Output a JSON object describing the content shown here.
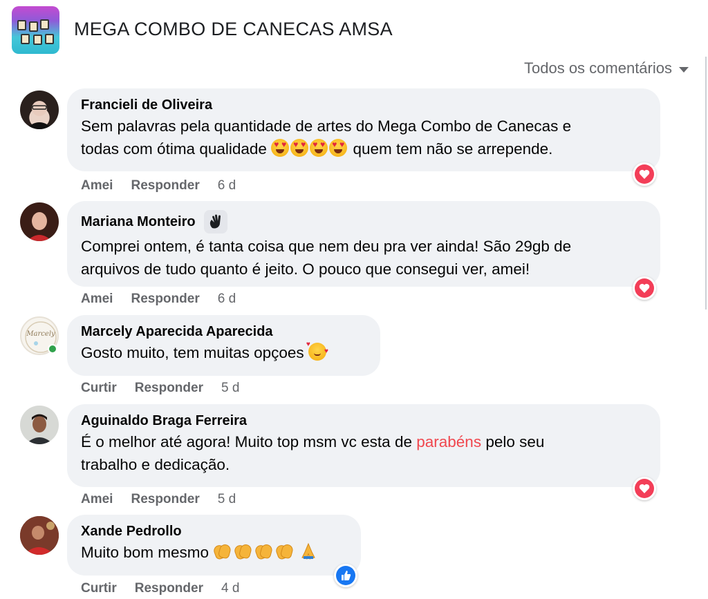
{
  "page": {
    "title": "MEGA COMBO DE CANECAS AMSA"
  },
  "filter": {
    "label": "Todos os comentários"
  },
  "comments": [
    {
      "author": "Francieli de Oliveira",
      "text_line1": "Sem palavras pela quantidade de artes do Mega Combo de Canecas e",
      "text_line2_pre": "todas com ótima qualidade",
      "text_line2_post": "quem tem não se arrepende.",
      "action": "Amei",
      "reply": "Responder",
      "time": "6 d",
      "reaction": "love"
    },
    {
      "author": "Mariana Monteiro",
      "text_line1": "Comprei ontem, é tanta coisa que nem deu pra ver ainda! São 29gb de",
      "text_line2": "arquivos de tudo quanto é jeito. O pouco que consegui ver, amei!",
      "action": "Amei",
      "reply": "Responder",
      "time": "6 d",
      "reaction": "love"
    },
    {
      "author": "Marcely Aparecida Aparecida",
      "text_line1": "Gosto muito, tem muitas opçoes",
      "avatar_text": "Marcely",
      "action": "Curtir",
      "reply": "Responder",
      "time": "5 d"
    },
    {
      "author": "Aguinaldo Braga Ferreira",
      "text_line1_pre": "É o melhor até agora! Muito top msm vc esta de",
      "text_line1_link": "parabéns",
      "text_line1_post": "pelo seu",
      "text_line2": "trabalho e dedicação.",
      "action": "Amei",
      "reply": "Responder",
      "time": "5 d",
      "reaction": "love"
    },
    {
      "author": "Xande Pedrollo",
      "text_line1": "Muito bom mesmo",
      "action": "Curtir",
      "reply": "Responder",
      "time": "4 d",
      "reaction": "like"
    }
  ],
  "colors": {
    "bubble": "#f0f2f5",
    "love": "#f33e58",
    "like": "#1877f2",
    "link": "#f0474e",
    "meta": "#65676b"
  }
}
